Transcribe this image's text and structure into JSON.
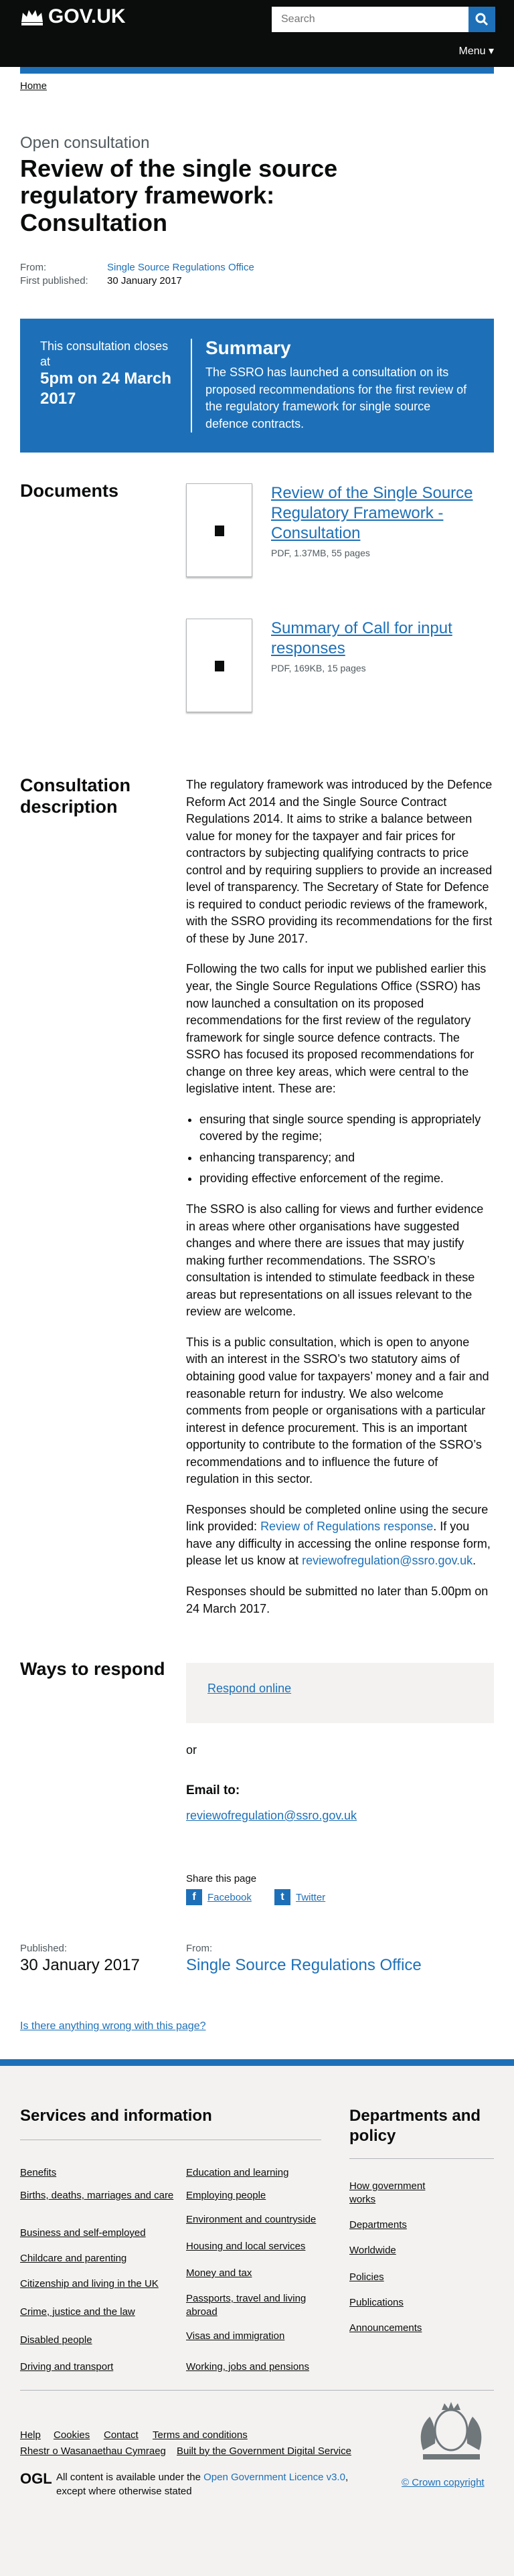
{
  "header": {
    "logotype": "GOV.UK",
    "search_placeholder": "Search",
    "menu_label": "Menu ▾"
  },
  "breadcrumb": "Home",
  "document_type": "Open consultation",
  "title": "Review of the single source regulatory framework: Consultation",
  "meta": {
    "from_label": "From:",
    "from_value": "Single Source Regulations Office",
    "published_label": "First published:",
    "published_value": "30 January 2017"
  },
  "summary_box": {
    "closes_prefix": "This consultation closes at",
    "closes_date": "5pm on 24 March 2017",
    "heading": "Summary",
    "text": "The SSRO has launched a consultation on its proposed recommendations for the first review of the regulatory framework for single source defence contracts."
  },
  "documents": {
    "heading": "Documents",
    "items": [
      {
        "title": "Review of the Single Source Regulatory Framework - Consultation",
        "meta": "PDF, 1.37MB, 55 pages"
      },
      {
        "title": "Summary of Call for input responses",
        "meta": "PDF, 169KB, 15 pages"
      }
    ]
  },
  "description": {
    "heading": "Consultation description",
    "p1": "The regulatory framework was introduced by the Defence Reform Act 2014 and the Single Source Contract Regulations 2014. It aims to strike a balance between value for money for the taxpayer and fair prices for contractors by subjecting qualifying contracts to price control and by requiring suppliers to provide an increased level of transparency. The Secretary of State for Defence is required to conduct periodic reviews of the framework, with the SSRO providing its recommendations for the first of these by June 2017.",
    "p2": "Following the two calls for input we published earlier this year, the Single Source Regulations Office (SSRO) has now launched a consultation on its proposed recommendations for the first review of the regulatory framework for single source defence contracts. The SSRO has focused its proposed recommendations for change on three key areas, which were central to the legislative intent. These are:",
    "bullets": [
      "ensuring that single source spending is appropriately covered by the regime;",
      "enhancing transparency; and",
      "providing effective enforcement of the regime."
    ],
    "p3": "The SSRO is also calling for views and further evidence in areas where other organisations have suggested changes and where there are issues that may justify making further recommendations. The SSRO’s consultation is intended to stimulate feedback in these areas but representations on all issues relevant to the review are welcome.",
    "p4": "This is a public consultation, which is open to anyone with an interest in the SSRO’s two statutory aims of obtaining good value for taxpayers’ money and a fair and reasonable return for industry. We also welcome comments from people or organisations with a particular interest in defence procurement. This is an important opportunity to contribute to the formation of the SSRO’s recommendations and to influence the future of regulation in this sector.",
    "p5_before": "Responses should be completed online using the secure link provided: ",
    "p5_link": "Review of Regulations response",
    "p5_mid": ". If you have any difficulty in accessing the online response form, please let us know at ",
    "p5_email": "reviewofregulation@ssro.gov.uk",
    "p5_after": ".",
    "p6": "Responses should be submitted no later than 5.00pm on 24 March 2017."
  },
  "respond": {
    "heading": "Ways to respond",
    "link": "Respond online",
    "or": "or",
    "email_heading": "Email to:",
    "email": "reviewofregulation@ssro.gov.uk"
  },
  "share": {
    "label": "Share this page",
    "facebook": "Facebook",
    "twitter": "Twitter"
  },
  "published_footer": {
    "published_label": "Published:",
    "published_value": "30 January 2017",
    "from_label": "From:",
    "from_value": "Single Source Regulations Office"
  },
  "feedback_link": "Is there anything wrong with this page?",
  "footer": {
    "services_heading": "Services and information",
    "services_col1": [
      "Benefits",
      "Births, deaths, marriages and care",
      "Business and self-employed",
      "Childcare and parenting",
      "Citizenship and living in the UK",
      "Crime, justice and the law",
      "Disabled people",
      "Driving and transport"
    ],
    "services_col2": [
      "Education and learning",
      "Employing people",
      "Environment and countryside",
      "Housing and local services",
      "Money and tax",
      "Passports, travel and living abroad",
      "Visas and immigration",
      "Working, jobs and pensions"
    ],
    "departments_heading": "Departments and policy",
    "departments": [
      "How government works",
      "Departments",
      "Worldwide",
      "Policies",
      "Publications",
      "Announcements"
    ],
    "meta_links": [
      "Help",
      "Cookies",
      "Contact",
      "Terms and conditions",
      "Rhestr o Wasanaethau Cymraeg",
      "Built by the Government Digital Service"
    ],
    "ogl": "OGL",
    "licence_before": "All content is available under the ",
    "licence_link": "Open Government Licence v3.0",
    "licence_after": ", except where otherwise stated",
    "copyright": "© Crown copyright"
  }
}
